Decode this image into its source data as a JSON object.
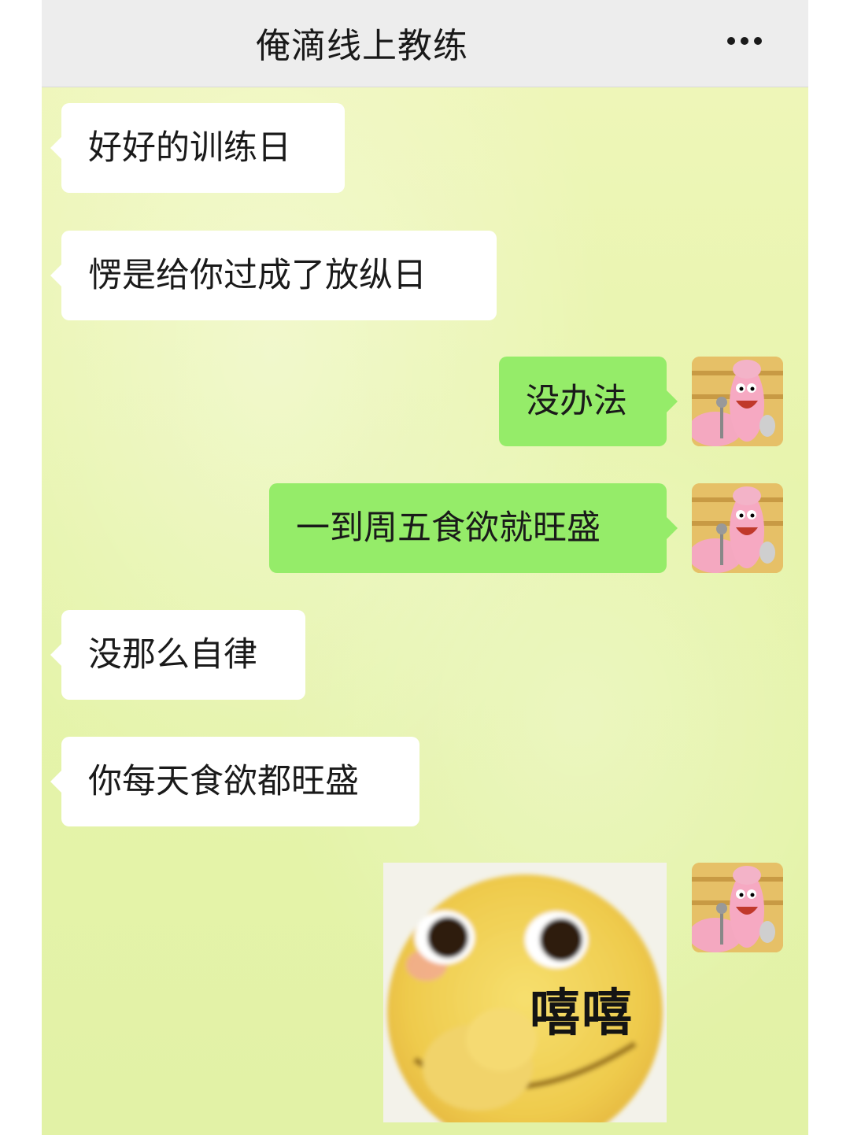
{
  "header": {
    "title": "俺滴线上教练"
  },
  "colors": {
    "header_bg": "#ededed",
    "chat_bg": "#e6f4ab",
    "incoming_bubble": "#ffffff",
    "outgoing_bubble": "#95ec69"
  },
  "messages": [
    {
      "sender": "coach",
      "text": "好好的训练日"
    },
    {
      "sender": "coach",
      "text": "愣是给你过成了放纵日"
    },
    {
      "sender": "me",
      "text": "没办法"
    },
    {
      "sender": "me",
      "text": "一到周五食欲就旺盛"
    },
    {
      "sender": "coach",
      "text": "没那么自律"
    },
    {
      "sender": "coach",
      "text": "你每天食欲都旺盛"
    },
    {
      "sender": "me",
      "type": "sticker",
      "icon": "smiling-emoji-sticker",
      "text": "嘻嘻"
    }
  ]
}
